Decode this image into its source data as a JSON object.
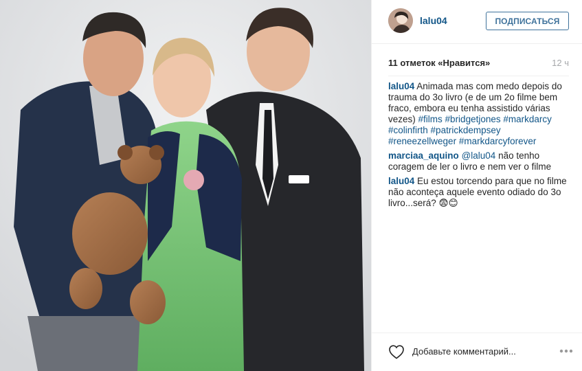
{
  "post": {
    "image_alt": "Photo of three people posing with a teddy bear"
  },
  "header": {
    "username": "lalu04",
    "follow_label": "ПОДПИСАТЬСЯ",
    "avatar_icon": "profile-avatar"
  },
  "meta": {
    "likes": "11 отметок «Нравится»",
    "time": "12 ч"
  },
  "comments": [
    {
      "user": "lalu04",
      "parts": [
        {
          "type": "text",
          "value": " Animada mas com medo depois do trauma do 3o livro (e de um 2o filme bem fraco, embora eu tenha assistido várias vezes) "
        },
        {
          "type": "tag",
          "value": "#films"
        },
        {
          "type": "text",
          "value": " "
        },
        {
          "type": "tag",
          "value": "#bridgetjones"
        },
        {
          "type": "text",
          "value": " "
        },
        {
          "type": "tag",
          "value": "#markdarcy"
        },
        {
          "type": "text",
          "value": " "
        },
        {
          "type": "tag",
          "value": "#colinfirth"
        },
        {
          "type": "text",
          "value": " "
        },
        {
          "type": "tag",
          "value": "#patrickdempsey"
        },
        {
          "type": "text",
          "value": " "
        },
        {
          "type": "tag",
          "value": "#reneezellweger"
        },
        {
          "type": "text",
          "value": " "
        },
        {
          "type": "tag",
          "value": "#markdarcyforever"
        }
      ]
    },
    {
      "user": "marciaa_aquino",
      "parts": [
        {
          "type": "text",
          "value": " "
        },
        {
          "type": "tag",
          "value": "@lalu04"
        },
        {
          "type": "text",
          "value": " não tenho coragem de ler o livro e nem ver o filme"
        }
      ]
    },
    {
      "user": "lalu04",
      "parts": [
        {
          "type": "text",
          "value": " Eu estou torcendo para que no filme não aconteça aquele evento odiado do 3o livro...será? 😨😊"
        }
      ]
    }
  ],
  "footer": {
    "comment_placeholder": "Добавьте комментарий...",
    "like_icon": "heart-outline-icon",
    "more_icon": "more-options-icon"
  },
  "colors": {
    "link": "#125688",
    "follow": "#3f729b",
    "muted": "#a5a7aa",
    "divider": "#efefef"
  }
}
